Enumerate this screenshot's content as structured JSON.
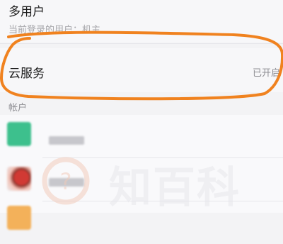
{
  "multi_user": {
    "title": "多用户",
    "subtitle": "当前登录的用户：机主"
  },
  "cloud_service": {
    "title": "云服务",
    "status": "已开启"
  },
  "accounts_section": {
    "label": "帐户"
  },
  "accounts": [
    {
      "icon": "green-app-icon",
      "color": "#3dc08d"
    },
    {
      "icon": "red-app-icon",
      "color": "#d13a34"
    },
    {
      "icon": "orange-app-icon",
      "color": "#f3b15a"
    }
  ],
  "watermark": {
    "text": "知百科"
  },
  "annotation": {
    "color": "#f0821f"
  }
}
